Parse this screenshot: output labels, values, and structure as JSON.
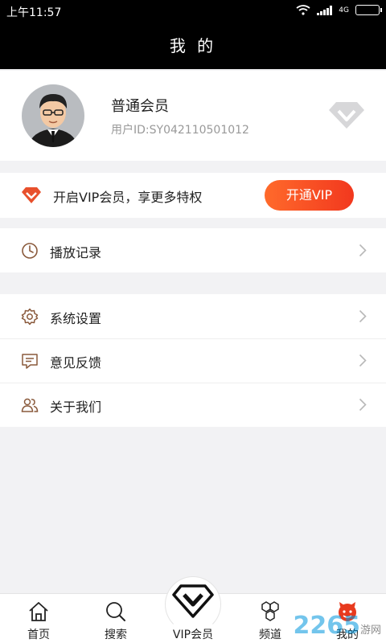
{
  "status_bar": {
    "time": "上午11:57",
    "network": "4G"
  },
  "header": {
    "title": "我 的"
  },
  "profile": {
    "member_type": "普通会员",
    "user_id": "用户ID:SY042110501012"
  },
  "vip_promo": {
    "text": "开启VIP会员，享更多特权",
    "button_label": "开通VIP"
  },
  "menu_group_1": [
    {
      "label": "播放记录",
      "icon": "clock-icon"
    }
  ],
  "menu_group_2": [
    {
      "label": "系统设置",
      "icon": "gear-icon"
    },
    {
      "label": "意见反馈",
      "icon": "feedback-icon"
    },
    {
      "label": "关于我们",
      "icon": "users-icon"
    }
  ],
  "tabs": [
    {
      "label": "首页",
      "icon": "home-icon"
    },
    {
      "label": "搜索",
      "icon": "search-icon"
    },
    {
      "label": "VIP会员",
      "icon": "vip-icon"
    },
    {
      "label": "频道",
      "icon": "hexagon-icon"
    },
    {
      "label": "我的",
      "icon": "profile-icon"
    }
  ],
  "watermark": {
    "text": "2265",
    "sub": "游网"
  },
  "colors": {
    "accent": "#f2381e",
    "header_bg": "#000000",
    "page_bg": "#f2f2f4",
    "icon_brown": "#8a5a3c"
  }
}
